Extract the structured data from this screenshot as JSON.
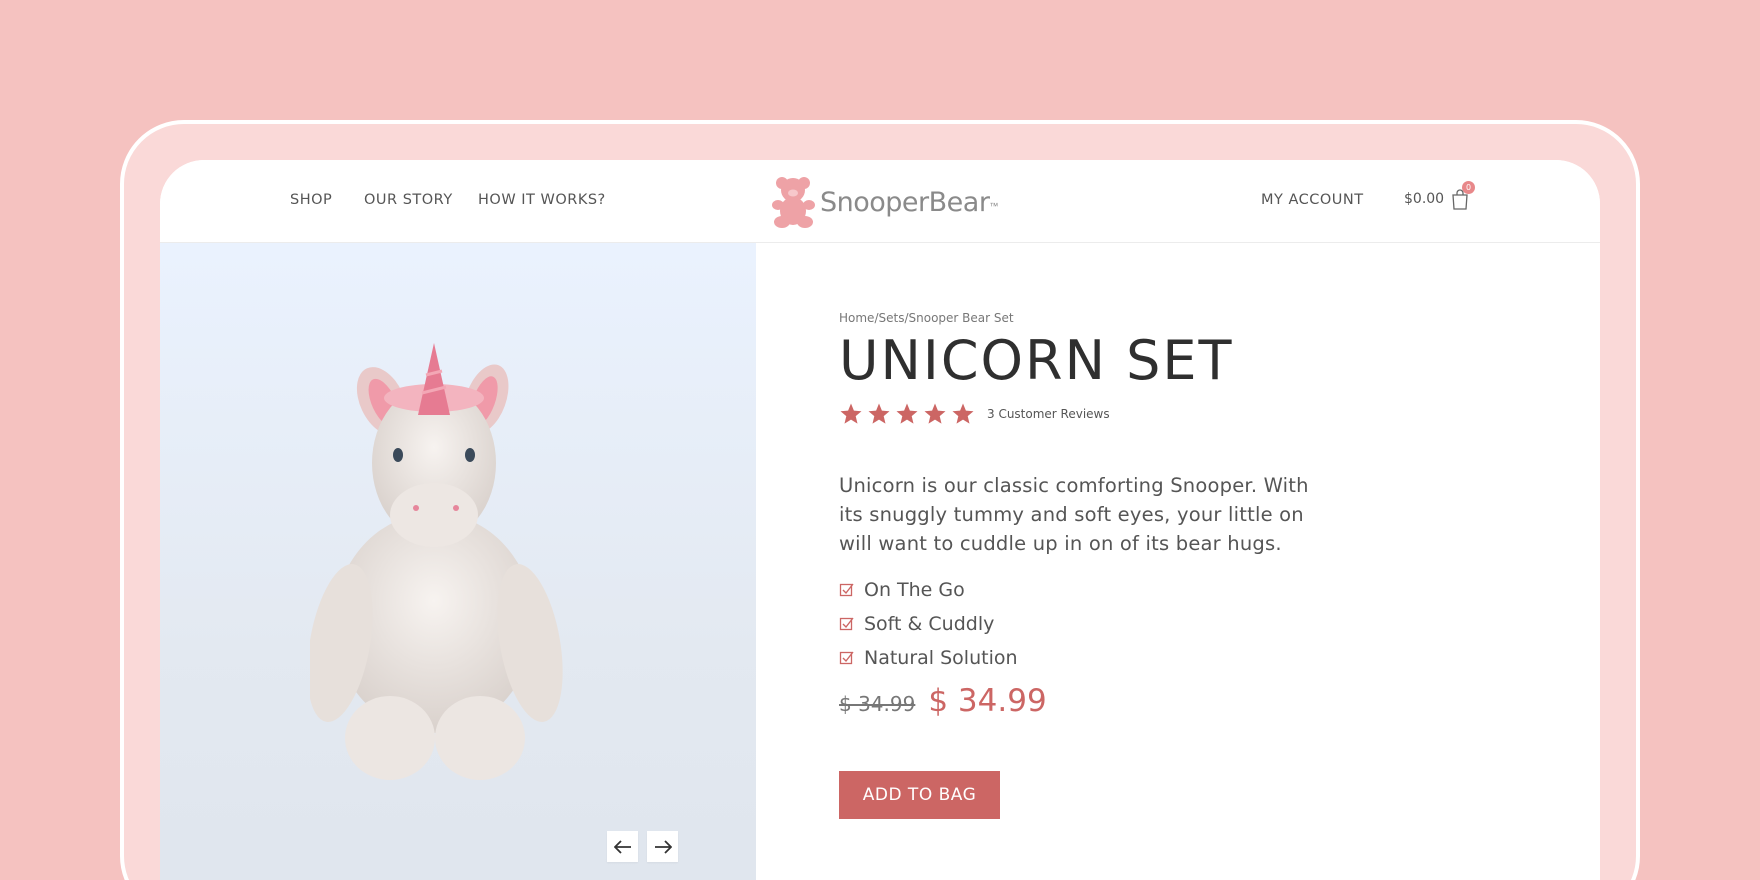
{
  "colors": {
    "background": "#f5c2c0",
    "frame": "#fad9d8",
    "accent": "#cc6664",
    "text": "#555555",
    "heading": "#2f2f2f"
  },
  "nav": {
    "left_items": [
      {
        "label": "SHOP"
      },
      {
        "label": "OUR STORY"
      },
      {
        "label": "HOW IT WORKS?"
      }
    ],
    "account_label": "MY ACCOUNT",
    "cart_total": "$0.00",
    "cart_count": "0",
    "cart_icon": "shopping-bag-icon"
  },
  "logo": {
    "text": "SnooperBear",
    "tm": "™",
    "icon": "teddy-bear-icon"
  },
  "gallery": {
    "prev_icon": "arrow-left-icon",
    "next_icon": "arrow-right-icon"
  },
  "product": {
    "breadcrumb": [
      "Home",
      "Sets",
      "Snooper Bear Set"
    ],
    "breadcrumb_sep": "/",
    "title": "UNICORN SET",
    "rating": 5,
    "rating_max": 5,
    "reviews_label": "3 Customer Reviews",
    "description": "Unicorn is our classic comforting Snooper. With its snuggly tummy and soft eyes, your little on will want to cuddle up in on of its bear hugs.",
    "features": [
      "On The Go",
      "Soft & Cuddly",
      "Natural Solution"
    ],
    "old_price": "$ 34.99",
    "price": "$ 34.99",
    "add_to_bag_label": "ADD TO BAG"
  }
}
